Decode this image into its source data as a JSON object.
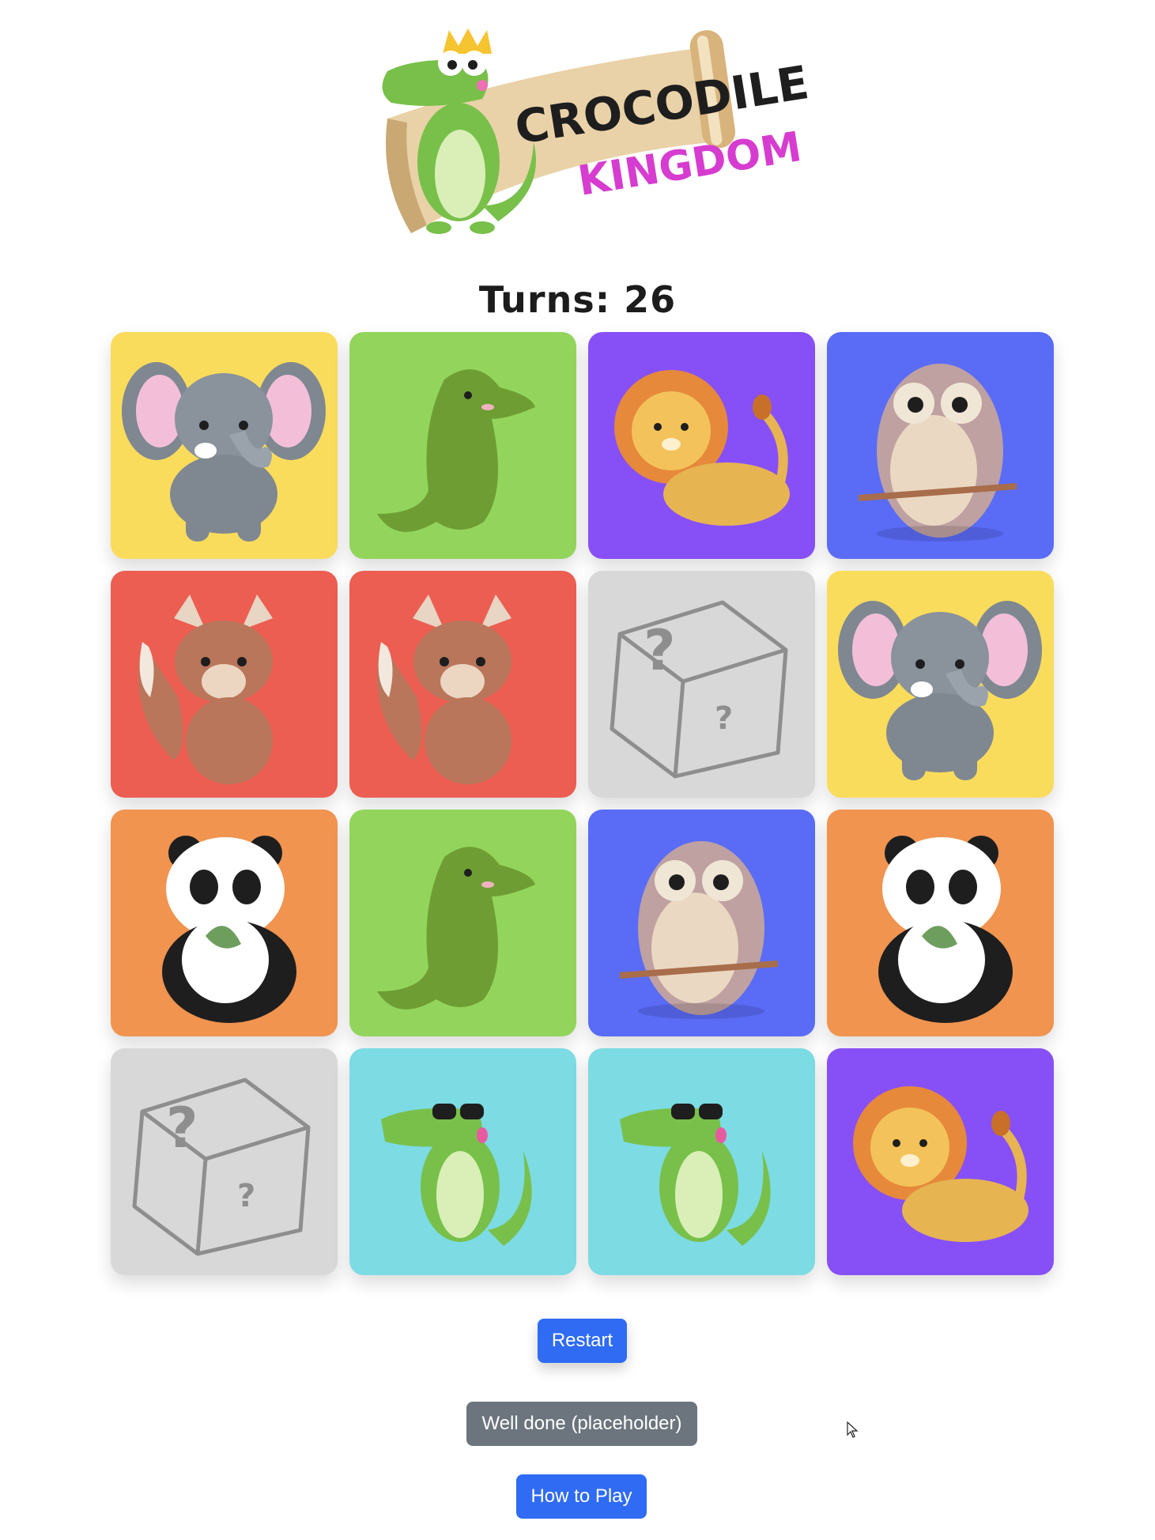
{
  "logo": {
    "line1": "CROCODILE",
    "line2": "KINGDOM",
    "line1_color": "#1e1e1e",
    "line2_color": "#d63ccf"
  },
  "turns_label": "Turns: 26",
  "colors": {
    "yellow": "#f9dc5c",
    "green": "#93d55c",
    "purple": "#8750f6",
    "blue": "#5a6cf6",
    "red": "#ec5e52",
    "orange": "#f09450",
    "cyan": "#7cdbe3",
    "hidden": "#d8d8d8",
    "button_primary": "#2f6bf3",
    "button_secondary": "#6c757d"
  },
  "board": {
    "rows": 4,
    "columns": 4,
    "cards": [
      {
        "animal": "elephant",
        "state": "revealed",
        "color": "#f9dc5c"
      },
      {
        "animal": "crocodile",
        "state": "revealed",
        "color": "#93d55c"
      },
      {
        "animal": "lion",
        "state": "revealed",
        "color": "#8750f6"
      },
      {
        "animal": "owl",
        "state": "revealed",
        "color": "#5a6cf6"
      },
      {
        "animal": "fox",
        "state": "revealed",
        "color": "#ec5e52"
      },
      {
        "animal": "fox",
        "state": "revealed",
        "color": "#ec5e52"
      },
      {
        "animal": "mystery-dice",
        "state": "hidden",
        "color": "#d8d8d8"
      },
      {
        "animal": "elephant",
        "state": "revealed",
        "color": "#f9dc5c"
      },
      {
        "animal": "panda",
        "state": "revealed",
        "color": "#f09450"
      },
      {
        "animal": "crocodile",
        "state": "revealed",
        "color": "#93d55c"
      },
      {
        "animal": "owl",
        "state": "revealed",
        "color": "#5a6cf6"
      },
      {
        "animal": "panda",
        "state": "revealed",
        "color": "#f09450"
      },
      {
        "animal": "mystery-dice",
        "state": "hidden",
        "color": "#d8d8d8"
      },
      {
        "animal": "cool-crocodile",
        "state": "revealed",
        "color": "#7cdbe3"
      },
      {
        "animal": "cool-crocodile",
        "state": "revealed",
        "color": "#7cdbe3"
      },
      {
        "animal": "lion",
        "state": "revealed",
        "color": "#8750f6"
      }
    ]
  },
  "buttons": {
    "restart": "Restart",
    "well_done": "Well done (placeholder)",
    "how_to_play": "How to Play"
  }
}
